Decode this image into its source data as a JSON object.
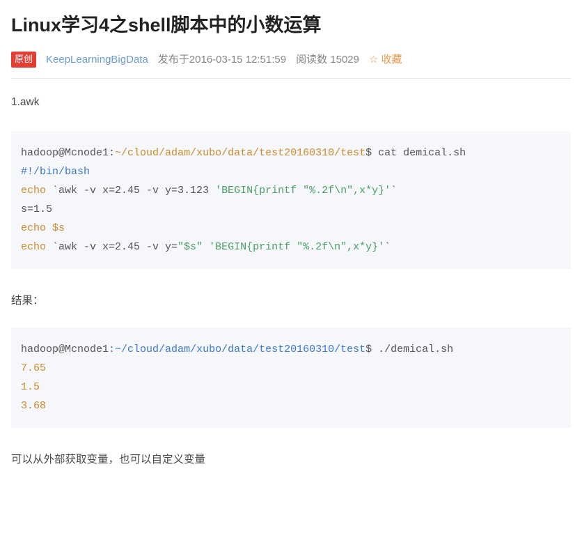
{
  "title": "Linux学习4之shell脚本中的小数运算",
  "meta": {
    "badge": "原创",
    "author": "KeepLearningBigData",
    "published": "发布于2016-03-15 12:51:59",
    "views": "阅读数 15029",
    "favorite": "收藏"
  },
  "content": {
    "section_label": "1.awk",
    "result_label": "结果：",
    "footer_note": "可以从外部获取变量，也可以自定义变量"
  },
  "code1": {
    "l1_user": "hadoop@Mcnode1",
    "l1_sep": ":",
    "l1_path": "~/cloud/adam/xubo/data/test20160310/",
    "l1_dir": "test",
    "l1_tail": "$ cat demical.sh",
    "l2": "#!/bin/bash",
    "l3_a": "echo",
    "l3_b": " `awk -v x=2.45 -v y=3.123 ",
    "l3_c": "'BEGIN{printf \"%.2f\\n\",x*y}'",
    "l3_d": "`",
    "l4": "s=1.5",
    "l5_a": "echo",
    "l5_b": " ",
    "l5_c": "$s",
    "l6_a": "echo",
    "l6_b": " `awk -v x=2.45 -v y=",
    "l6_c": "\"$s\"",
    "l6_d": " ",
    "l6_e": "'BEGIN{printf \"%.2f\\n\",x*y}'",
    "l6_f": "`"
  },
  "code2": {
    "l1_user": "hadoop@Mcnode1",
    "l1_sep": ":",
    "l1_path": "~/cloud/adam/xubo/data/test20160310/test",
    "l1_tail": "$ ./demical.sh",
    "l2": "7.65",
    "l3": "1.5",
    "l4": "3.68"
  }
}
